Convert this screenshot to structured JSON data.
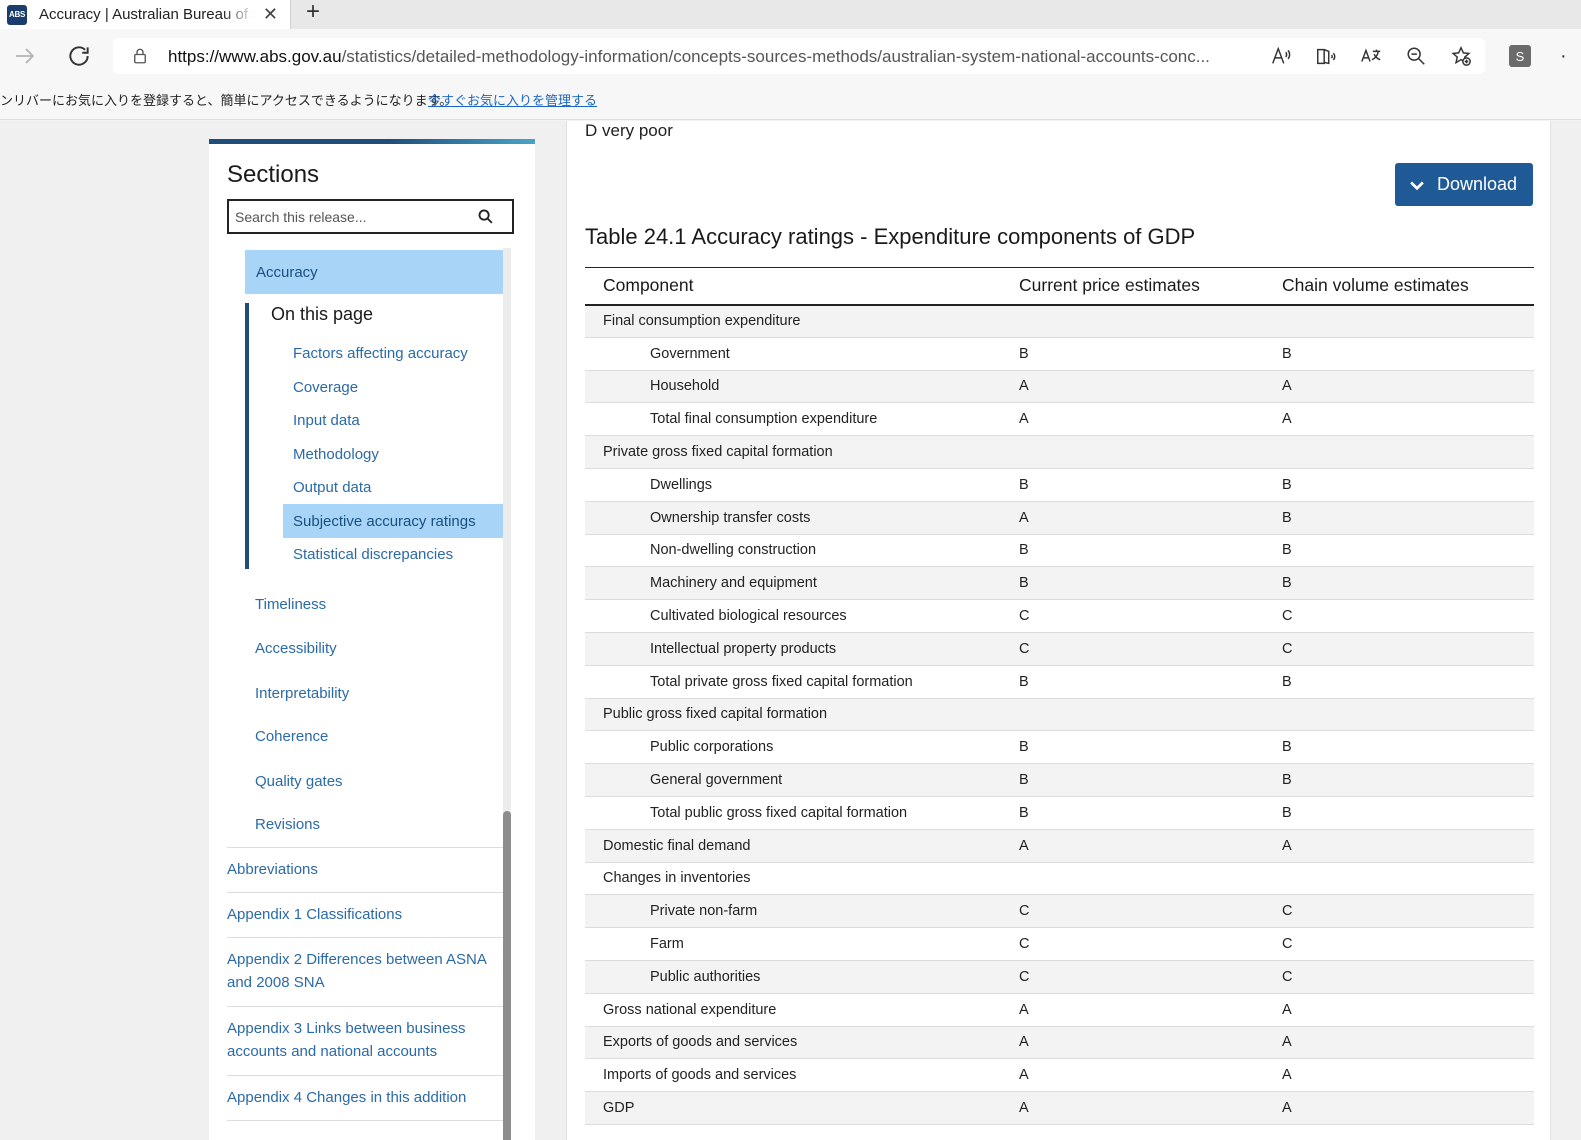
{
  "browser": {
    "tab_title": "Accuracy | Australian Bureau of Statistics",
    "favicon_text": "ABS",
    "url_host": "https://www.abs.gov.au",
    "url_path": "/statistics/detailed-methodology-information/concepts-sources-methods/australian-system-national-accounts-conc...",
    "profile_initial": "S",
    "favbar_text": "ンリバーにお気に入りを登録すると、簡単にアクセスできるようになります。",
    "favbar_link": "今すぐお気に入りを管理する",
    "icons": [
      "forward-icon",
      "reload-icon",
      "lock-icon",
      "read-aloud-icon",
      "immersive-reader-icon",
      "translate-icon",
      "zoom-out-icon",
      "add-favorite-icon"
    ]
  },
  "sidebar": {
    "heading": "Sections",
    "search_placeholder": "Search this release...",
    "active_section": "Accuracy",
    "on_this_page": {
      "heading": "On this page",
      "items": [
        "Factors affecting accuracy",
        "Coverage",
        "Input data",
        "Methodology",
        "Output data",
        "Subjective accuracy ratings",
        "Statistical discrepancies"
      ],
      "selected": "Subjective accuracy ratings"
    },
    "subsections": [
      "Timeliness",
      "Accessibility",
      "Interpretability",
      "Coherence",
      "Quality gates",
      "Revisions"
    ],
    "top_links": [
      "Abbreviations",
      "Appendix 1 Classifications",
      "Appendix 2 Differences between ASNA and 2008 SNA",
      "Appendix 3 Links between business accounts and national accounts",
      "Appendix 4 Changes in this addition"
    ]
  },
  "main": {
    "previous_line": "D very poor",
    "download_label": "Download",
    "table": {
      "title": "Table 24.1 Accuracy ratings - Expenditure components of GDP",
      "headers": [
        "Component",
        "Current price estimates",
        "Chain volume estimates"
      ],
      "rows": [
        {
          "component": "Final consumption expenditure",
          "current": "",
          "chain": "",
          "indent": false
        },
        {
          "component": "Government",
          "current": "B",
          "chain": "B",
          "indent": true
        },
        {
          "component": "Household",
          "current": "A",
          "chain": "A",
          "indent": true
        },
        {
          "component": "Total final consumption expenditure",
          "current": "A",
          "chain": "A",
          "indent": true
        },
        {
          "component": "Private gross fixed capital formation",
          "current": "",
          "chain": "",
          "indent": false
        },
        {
          "component": "Dwellings",
          "current": "B",
          "chain": "B",
          "indent": true
        },
        {
          "component": "Ownership transfer costs",
          "current": "A",
          "chain": "B",
          "indent": true
        },
        {
          "component": "Non-dwelling construction",
          "current": "B",
          "chain": "B",
          "indent": true
        },
        {
          "component": "Machinery and equipment",
          "current": "B",
          "chain": "B",
          "indent": true
        },
        {
          "component": "Cultivated biological resources",
          "current": "C",
          "chain": "C",
          "indent": true
        },
        {
          "component": "Intellectual property products",
          "current": "C",
          "chain": "C",
          "indent": true
        },
        {
          "component": "Total private gross fixed capital formation",
          "current": "B",
          "chain": "B",
          "indent": true
        },
        {
          "component": "Public gross fixed capital formation",
          "current": "",
          "chain": "",
          "indent": false
        },
        {
          "component": "Public corporations",
          "current": "B",
          "chain": "B",
          "indent": true
        },
        {
          "component": "General government",
          "current": "B",
          "chain": "B",
          "indent": true
        },
        {
          "component": "Total public gross fixed capital formation",
          "current": "B",
          "chain": "B",
          "indent": true
        },
        {
          "component": "Domestic final demand",
          "current": "A",
          "chain": "A",
          "indent": false
        },
        {
          "component": "Changes in inventories",
          "current": "",
          "chain": "",
          "indent": false
        },
        {
          "component": "Private non-farm",
          "current": "C",
          "chain": "C",
          "indent": true
        },
        {
          "component": "Farm",
          "current": "C",
          "chain": "C",
          "indent": true
        },
        {
          "component": "Public authorities",
          "current": "C",
          "chain": "C",
          "indent": true
        },
        {
          "component": "Gross national expenditure",
          "current": "A",
          "chain": "A",
          "indent": false
        },
        {
          "component": "Exports of goods and services",
          "current": "A",
          "chain": "A",
          "indent": false
        },
        {
          "component": "Imports of goods and services",
          "current": "A",
          "chain": "A",
          "indent": false
        },
        {
          "component": "GDP",
          "current": "A",
          "chain": "A",
          "indent": false
        }
      ]
    }
  }
}
